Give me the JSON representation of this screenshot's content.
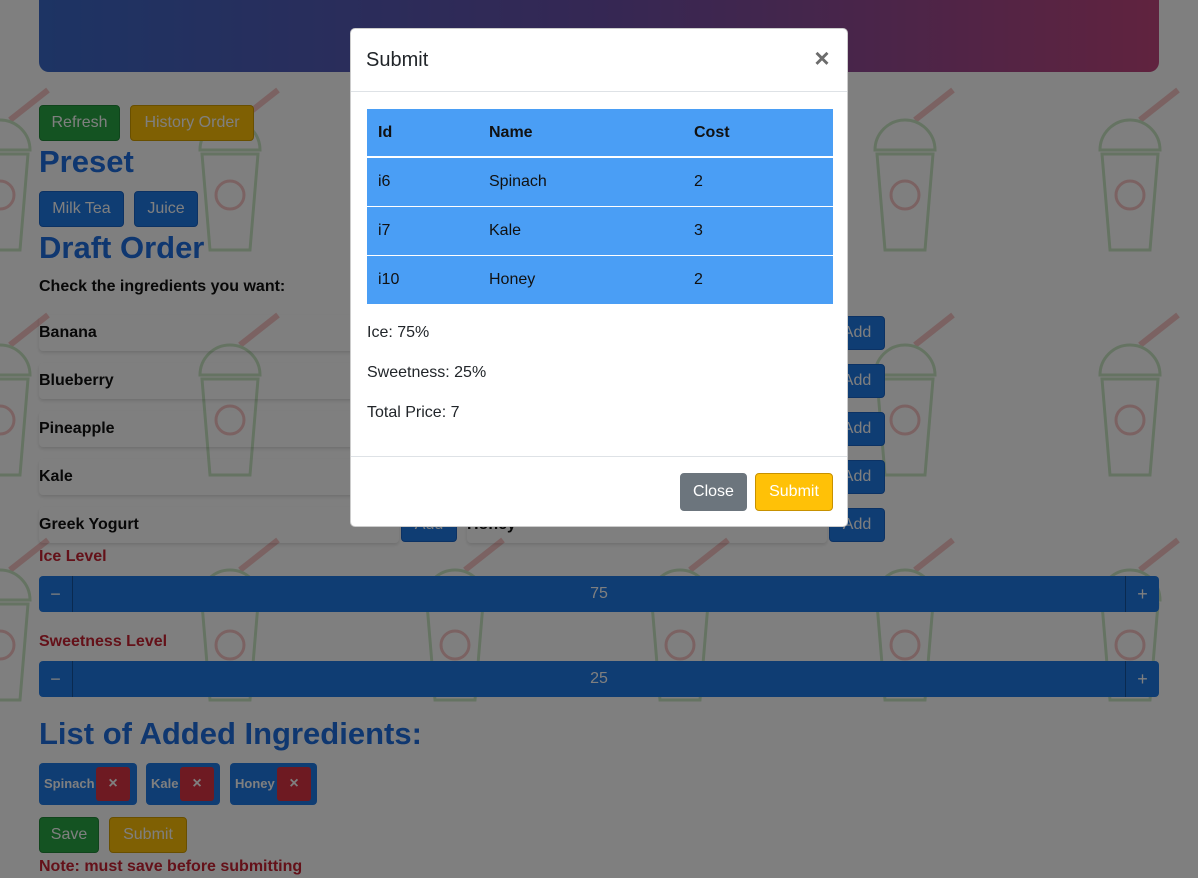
{
  "toolbar": {
    "refresh_label": "Refresh",
    "history_label": "History Order"
  },
  "preset": {
    "heading": "Preset",
    "buttons": [
      "Milk Tea",
      "Juice"
    ]
  },
  "draft": {
    "heading": "Draft Order",
    "instruction": "Check the ingredients you want:",
    "left_ingredients": [
      "Banana",
      "Blueberry",
      "Pineapple",
      "Kale",
      "Greek Yogurt"
    ],
    "right_ingredients": [
      "",
      "",
      "",
      "",
      "Honey"
    ],
    "add_label": "Add"
  },
  "ice": {
    "label": "Ice Level",
    "value": "75",
    "minus": "−",
    "plus": "+"
  },
  "sweetness": {
    "label": "Sweetness Level",
    "value": "25",
    "minus": "−",
    "plus": "+"
  },
  "added": {
    "heading": "List of Added Ingredients:",
    "chips": [
      "Spinach",
      "Kale",
      "Honey"
    ],
    "remove_symbol": "×"
  },
  "actions": {
    "save_label": "Save",
    "submit_label": "Submit",
    "note": "Note: must save before submitting"
  },
  "modal": {
    "title": "Submit",
    "close_symbol": "×",
    "columns": [
      "Id",
      "Name",
      "Cost"
    ],
    "rows": [
      [
        "i6",
        "Spinach",
        "2"
      ],
      [
        "i7",
        "Kale",
        "3"
      ],
      [
        "i10",
        "Honey",
        "2"
      ]
    ],
    "ice_text": "Ice: 75%",
    "sweetness_text": "Sweetness: 25%",
    "total_text": "Total Price: 7",
    "close_label": "Close",
    "submit_label": "Submit"
  },
  "colors": {
    "primary": "#1e7ae6",
    "success": "#28a745",
    "warning": "#ffc107",
    "danger": "#dc3545",
    "heading": "#1e6ee0",
    "table_bg": "#4a9ef5"
  }
}
